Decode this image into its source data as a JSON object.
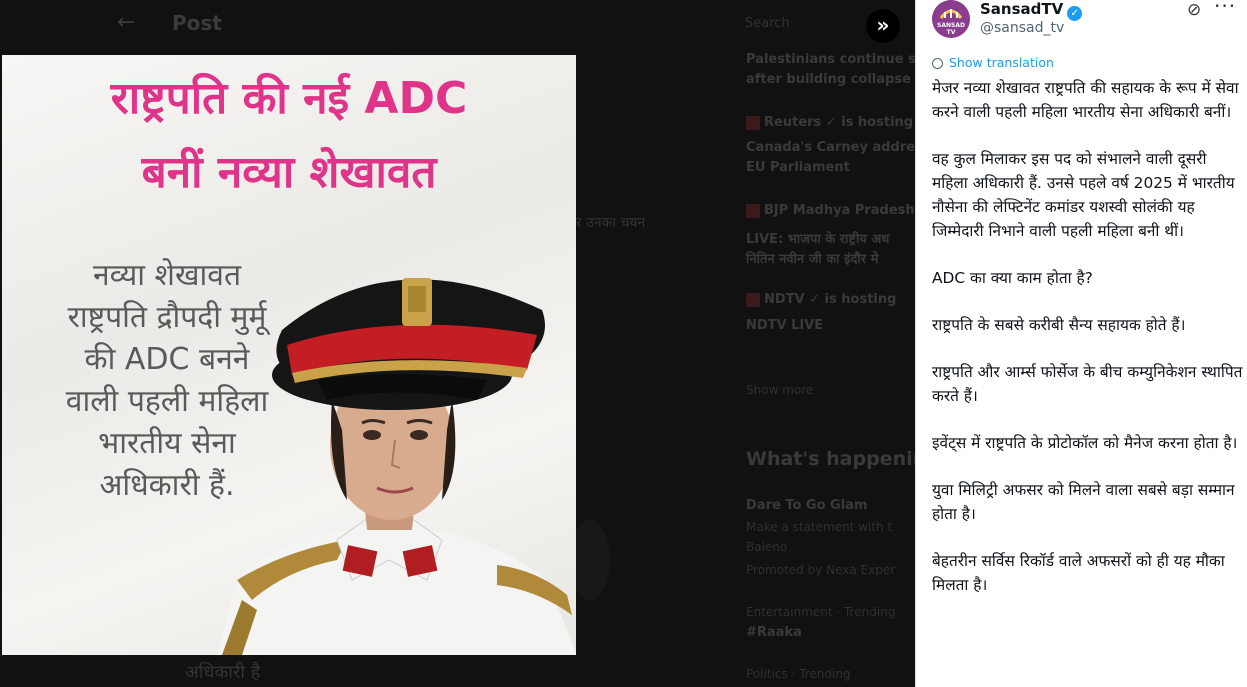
{
  "background": {
    "page_title": "Post",
    "search_placeholder": "Search",
    "mid_text": "र उनका चयन",
    "low_text": "अधिकारी है",
    "trends": [
      {
        "text": "Palestinians continue s",
        "top": 0
      },
      {
        "text": "after building collapse",
        "top": 0
      },
      {
        "text": "Reuters ✓ is hosting",
        "top": 0
      },
      {
        "text": "Canada's Carney addre",
        "top": 0
      },
      {
        "text": "EU Parliament",
        "top": 0
      },
      {
        "text": "BJP Madhya Pradesh",
        "top": 0
      },
      {
        "text": "LIVE: भाजपा के राष्ट्रीय अध",
        "top": 0
      },
      {
        "text": "नितिन नवीन जी का इंदौर मे",
        "top": 0
      },
      {
        "text": "NDTV ✓ is hosting",
        "top": 0
      },
      {
        "text": "NDTV LIVE",
        "top": 0
      },
      {
        "text": "Show more",
        "top": 0
      },
      {
        "text": "What's happenin",
        "top": 0
      },
      {
        "text": "Dare To Go Glam",
        "top": 0
      },
      {
        "text": "Make a statement with t",
        "top": 0
      },
      {
        "text": "Baleno",
        "top": 0
      },
      {
        "text": "Promoted by Nexa Exper",
        "top": 0
      },
      {
        "text": "Entertainment · Trending",
        "top": 0
      },
      {
        "text": "#Raaka",
        "top": 0
      },
      {
        "text": "Politics · Trending",
        "top": 0
      }
    ]
  },
  "media": {
    "headline_line1": "राष्ट्रपति की नई ADC",
    "headline_line2": "बनीं नव्या शेखावत",
    "caption_lines": [
      "नव्या शेखावत",
      "राष्ट्रपति द्रौपदी मुर्मू",
      "की ADC बनने",
      "वाली पहली महिला",
      "भारतीय सेना",
      "अधिकारी हैं."
    ]
  },
  "post": {
    "display_name": "SansadTV",
    "handle": "@sansad_tv",
    "avatar_label": "SANSAD TV",
    "show_translation": "Show translation",
    "paragraphs": [
      "मेजर नव्या शेखावत राष्ट्रपति की सहायक के रूप में सेवा करने वाली पहली महिला भारतीय सेना अधिकारी बनीं।",
      "वह कुल मिलाकर इस पद को संभालने वाली दूसरी महिला अधिकारी हैं. उनसे पहले वर्ष 2025 में भारतीय नौसेना की लेफ्टिनेंट कमांडर यशस्वी सोलंकी यह जिम्मेदारी निभाने वाली पहली महिला बनी थीं।",
      "ADC का क्या काम होता है?",
      "राष्ट्रपति के सबसे करीबी सैन्य सहायक होते हैं।",
      "राष्ट्रपति और आर्म्स फोर्सेज के बीच कम्युनिकेशन स्थापित करते हैं।",
      "इवेंट्स में राष्ट्रपति के प्रोटोकॉल को मैनेज करना होता है।",
      "युवा मिलिट्री अफसर को मिलने वाला सबसे बड़ा सम्मान होता है।",
      "बेहतरीन सर्विस रिकॉर्ड वाले अफसरों को ही यह मौका मिलता है।"
    ]
  },
  "colors": {
    "headline": "#e0338a",
    "link": "#1d9bf0",
    "verified": "#1d9bf0"
  }
}
